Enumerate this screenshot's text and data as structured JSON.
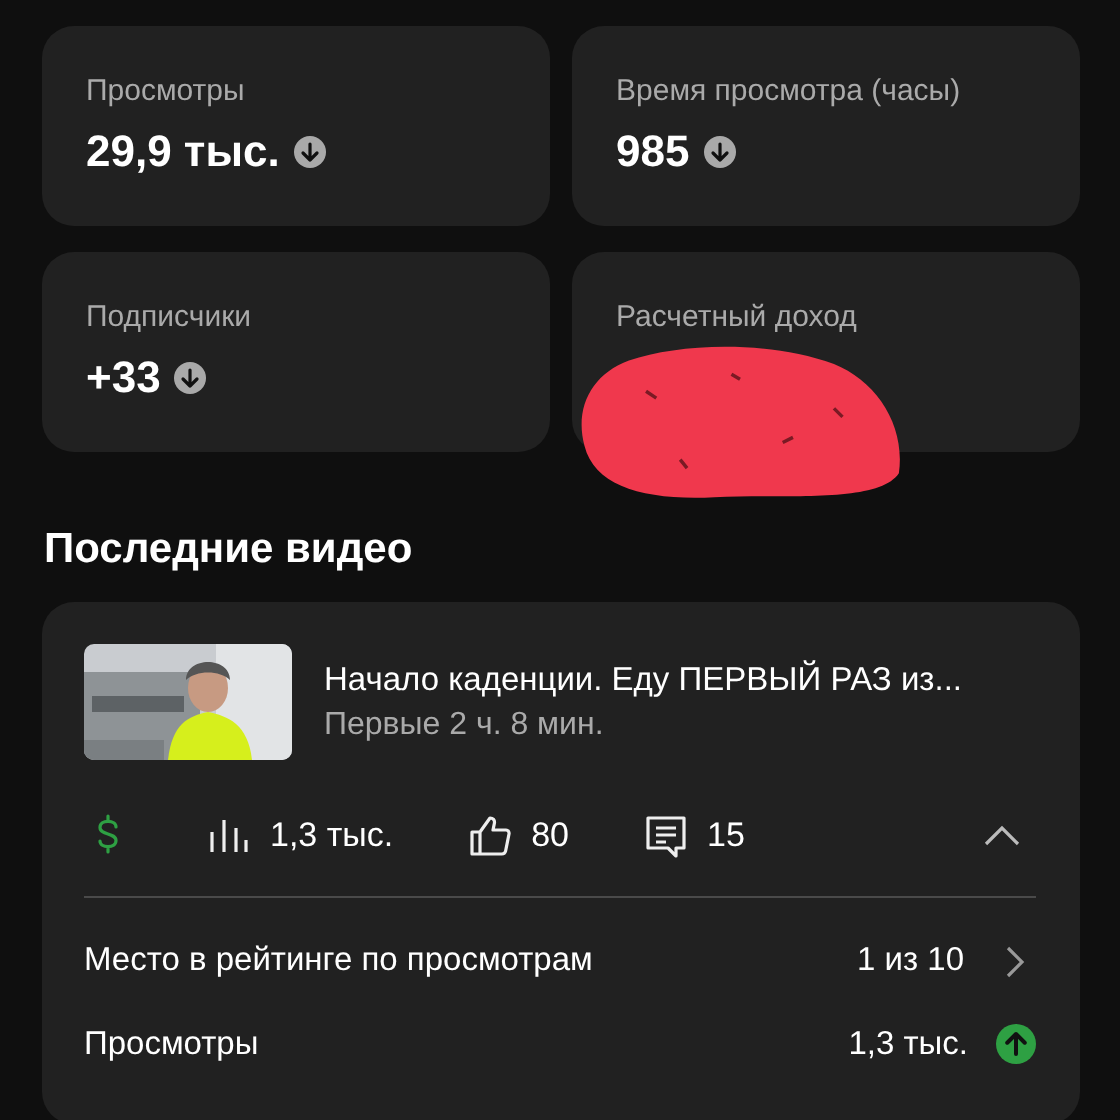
{
  "metrics": [
    {
      "label": "Просмотры",
      "value": "29,9 тыс.",
      "rising": false
    },
    {
      "label": "Время просмотра (часы)",
      "value": "985",
      "rising": false
    },
    {
      "label": "Подписчики",
      "value": "+33",
      "rising": false
    },
    {
      "label": "Расчетный доход",
      "redacted": true
    }
  ],
  "recent": {
    "heading": "Последние видео",
    "video": {
      "title": "Начало каденции. Еду ПЕРВЫЙ РАЗ из...",
      "subtitle": "Первые 2 ч. 8 мин.",
      "stats": [
        {
          "kind": "revenue"
        },
        {
          "kind": "views",
          "text": "1,3 тыс."
        },
        {
          "kind": "likes",
          "text": "80"
        },
        {
          "kind": "comments",
          "text": "15"
        }
      ],
      "expanded": true,
      "rows": [
        {
          "label": "Место в рейтинге по просмотрам",
          "value": "1 из 10",
          "kind": "link"
        },
        {
          "label": "Просмотры",
          "value": "1,3 тыс.",
          "kind": "trend",
          "rising": true
        }
      ]
    }
  }
}
